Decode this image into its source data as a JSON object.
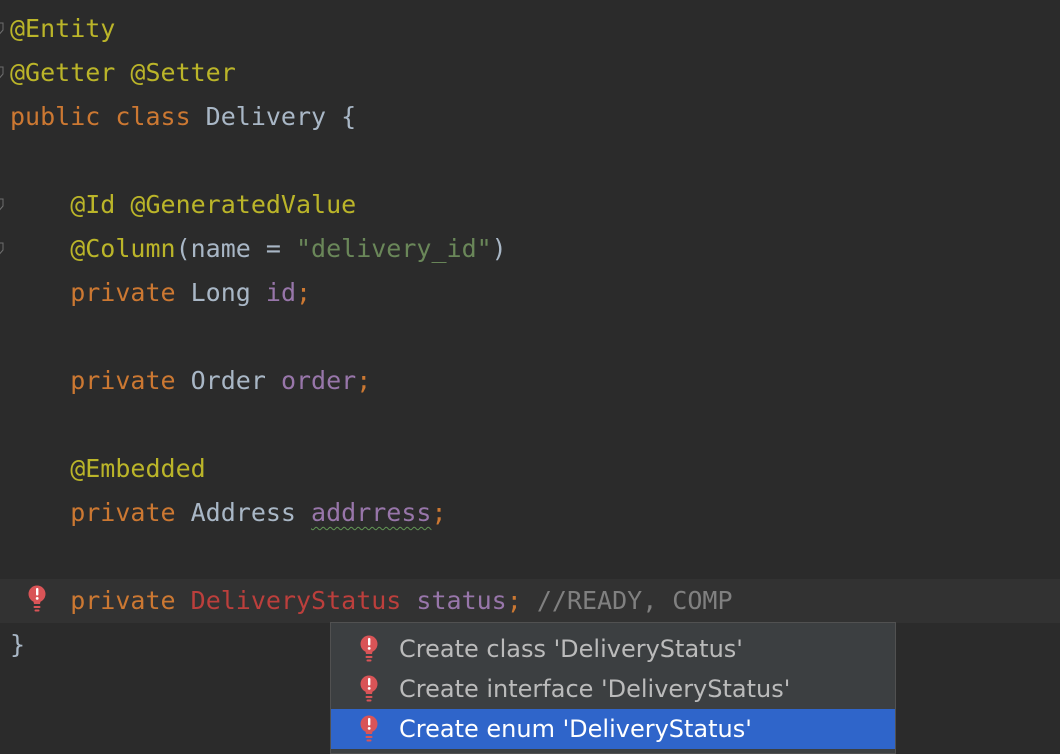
{
  "editor": {
    "lines": [
      {
        "tokens": [
          {
            "text": "@Entity",
            "kind": "annotation"
          }
        ]
      },
      {
        "tokens": [
          {
            "text": "@Getter @Setter",
            "kind": "annotation"
          }
        ]
      },
      {
        "tokens": [
          {
            "text": "public class",
            "kind": "keyword"
          },
          {
            "text": " Delivery {",
            "kind": "plain"
          }
        ]
      },
      {
        "tokens": []
      },
      {
        "tokens": [
          {
            "text": "    @Id @GeneratedValue",
            "kind": "annotation"
          }
        ]
      },
      {
        "tokens": [
          {
            "text": "    @Column",
            "kind": "annotation"
          },
          {
            "text": "(name = ",
            "kind": "plain"
          },
          {
            "text": "\"delivery_id\"",
            "kind": "string"
          },
          {
            "text": ")",
            "kind": "plain"
          }
        ]
      },
      {
        "tokens": [
          {
            "text": "    private",
            "kind": "keyword"
          },
          {
            "text": " Long ",
            "kind": "plain"
          },
          {
            "text": "id",
            "kind": "field"
          },
          {
            "text": ";",
            "kind": "keyword"
          }
        ]
      },
      {
        "tokens": []
      },
      {
        "tokens": [
          {
            "text": "    private",
            "kind": "keyword"
          },
          {
            "text": " Order ",
            "kind": "plain"
          },
          {
            "text": "order",
            "kind": "field"
          },
          {
            "text": ";",
            "kind": "keyword"
          }
        ]
      },
      {
        "tokens": []
      },
      {
        "tokens": [
          {
            "text": "    @Embedded",
            "kind": "annotation"
          }
        ]
      },
      {
        "tokens": [
          {
            "text": "    private",
            "kind": "keyword"
          },
          {
            "text": " Address ",
            "kind": "plain"
          },
          {
            "text": "addrress",
            "kind": "field",
            "squiggle": true
          },
          {
            "text": ";",
            "kind": "keyword"
          }
        ]
      },
      {
        "tokens": []
      },
      {
        "tokens": [
          {
            "text": "    private",
            "kind": "keyword"
          },
          {
            "text": " ",
            "kind": "plain"
          },
          {
            "text": "DeliveryStatus",
            "kind": "error"
          },
          {
            "text": " ",
            "kind": "plain"
          },
          {
            "text": "status",
            "kind": "field"
          },
          {
            "text": ";",
            "kind": "keyword"
          },
          {
            "text": " //READY, COMP",
            "kind": "comment"
          }
        ],
        "current": true,
        "gutter_icon": "error-bulb-icon"
      },
      {
        "tokens": [
          {
            "text": "}",
            "kind": "plain"
          }
        ]
      }
    ],
    "fold_marker_lines": [
      0,
      1,
      4,
      5
    ]
  },
  "quick_fix_popup": {
    "items": [
      {
        "label": "Create class 'DeliveryStatus'",
        "icon": "error-bulb-icon",
        "selected": false
      },
      {
        "label": "Create interface 'DeliveryStatus'",
        "icon": "error-bulb-icon",
        "selected": false
      },
      {
        "label": "Create enum 'DeliveryStatus'",
        "icon": "error-bulb-icon",
        "selected": true
      }
    ]
  },
  "colors": {
    "background": "#2b2b2b",
    "current_line": "#323232",
    "annotation": "#bbb529",
    "keyword": "#cc7832",
    "plain": "#a9b7c6",
    "string": "#6a8759",
    "field": "#9876aa",
    "error": "#bc3f3c",
    "comment": "#808080",
    "popup_background": "#3c3f41",
    "popup_selection": "#2f65ca",
    "bulb": "#d95457"
  }
}
